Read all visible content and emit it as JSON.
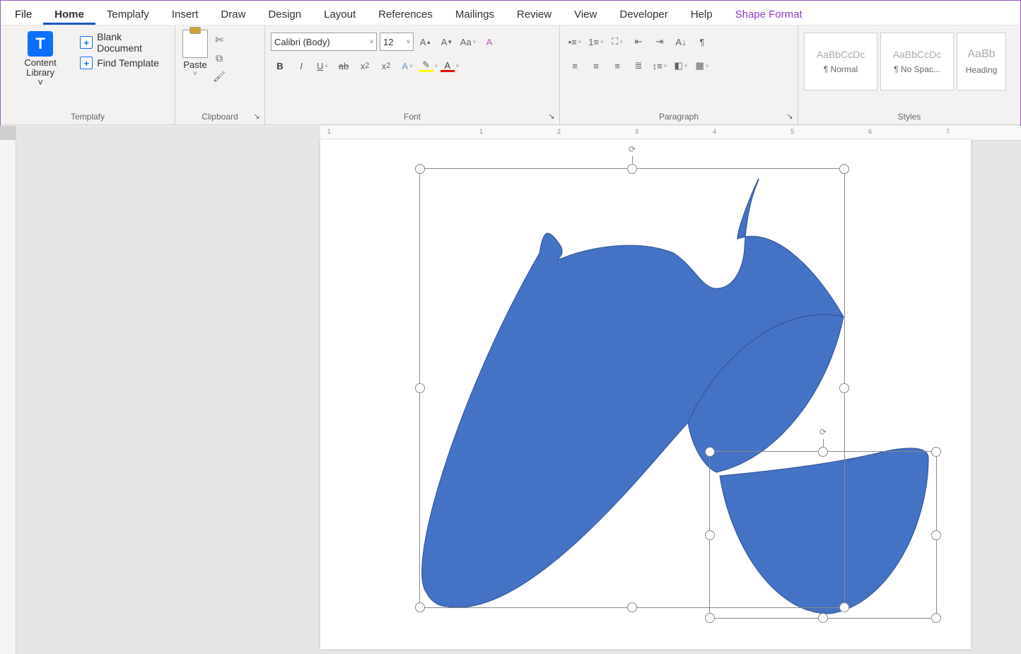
{
  "menu": {
    "file": "File",
    "home": "Home",
    "templafy": "Templafy",
    "insert": "Insert",
    "draw": "Draw",
    "design": "Design",
    "layout": "Layout",
    "references": "References",
    "mailings": "Mailings",
    "review": "Review",
    "view": "View",
    "developer": "Developer",
    "help": "Help",
    "shape_format": "Shape Format"
  },
  "ribbon": {
    "templafy": {
      "content_library": "Content Library",
      "content_library_chev": "˅",
      "blank_document": "Blank Document",
      "find_template": "Find Template",
      "label": "Templafy"
    },
    "clipboard": {
      "paste": "Paste",
      "label": "Clipboard"
    },
    "font": {
      "name": "Calibri (Body)",
      "size": "12",
      "label": "Font"
    },
    "paragraph": {
      "label": "Paragraph"
    },
    "styles": {
      "label": "Styles",
      "preview": "AaBbCcDc",
      "preview_cut": "AaBb",
      "normal": "¶ Normal",
      "no_spacing": "¶ No Spac...",
      "heading": "Heading"
    }
  },
  "ruler": {
    "marks": [
      "1",
      "1",
      "2",
      "3",
      "4",
      "5",
      "6",
      "7"
    ]
  }
}
